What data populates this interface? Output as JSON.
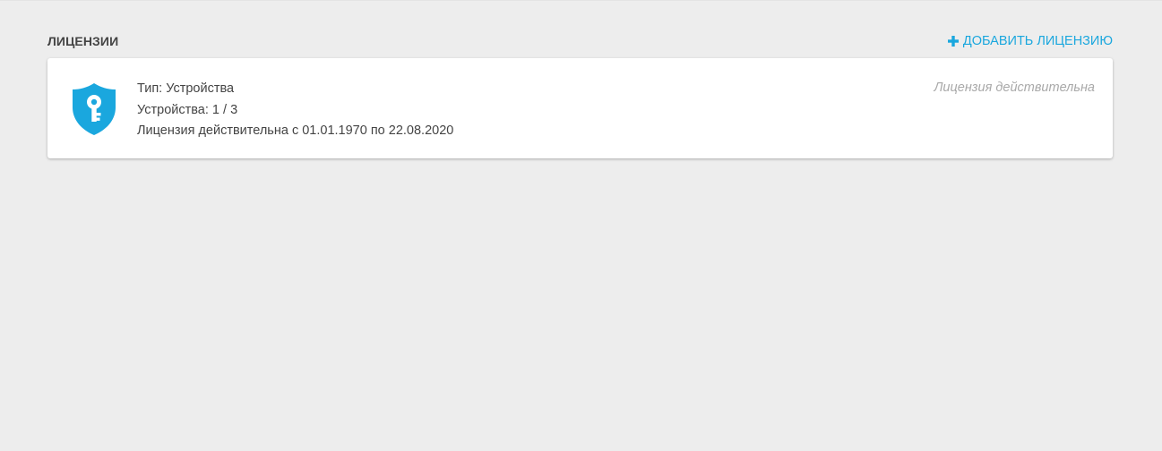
{
  "header": {
    "title": "ЛИЦЕНЗИИ",
    "add_label": "ДОБАВИТЬ ЛИЦЕНЗИЮ"
  },
  "license": {
    "icon": "shield-key-icon",
    "type_line": "Тип: Устройства",
    "devices_line": "Устройства: 1 / 3",
    "validity_line": "Лицензия действительна с 01.01.1970 по 22.08.2020",
    "status": "Лицензия действительна"
  },
  "colors": {
    "accent": "#1aa7de",
    "background": "#ededed",
    "card": "#ffffff",
    "text": "#444444",
    "status_text": "#a9a9a9"
  }
}
